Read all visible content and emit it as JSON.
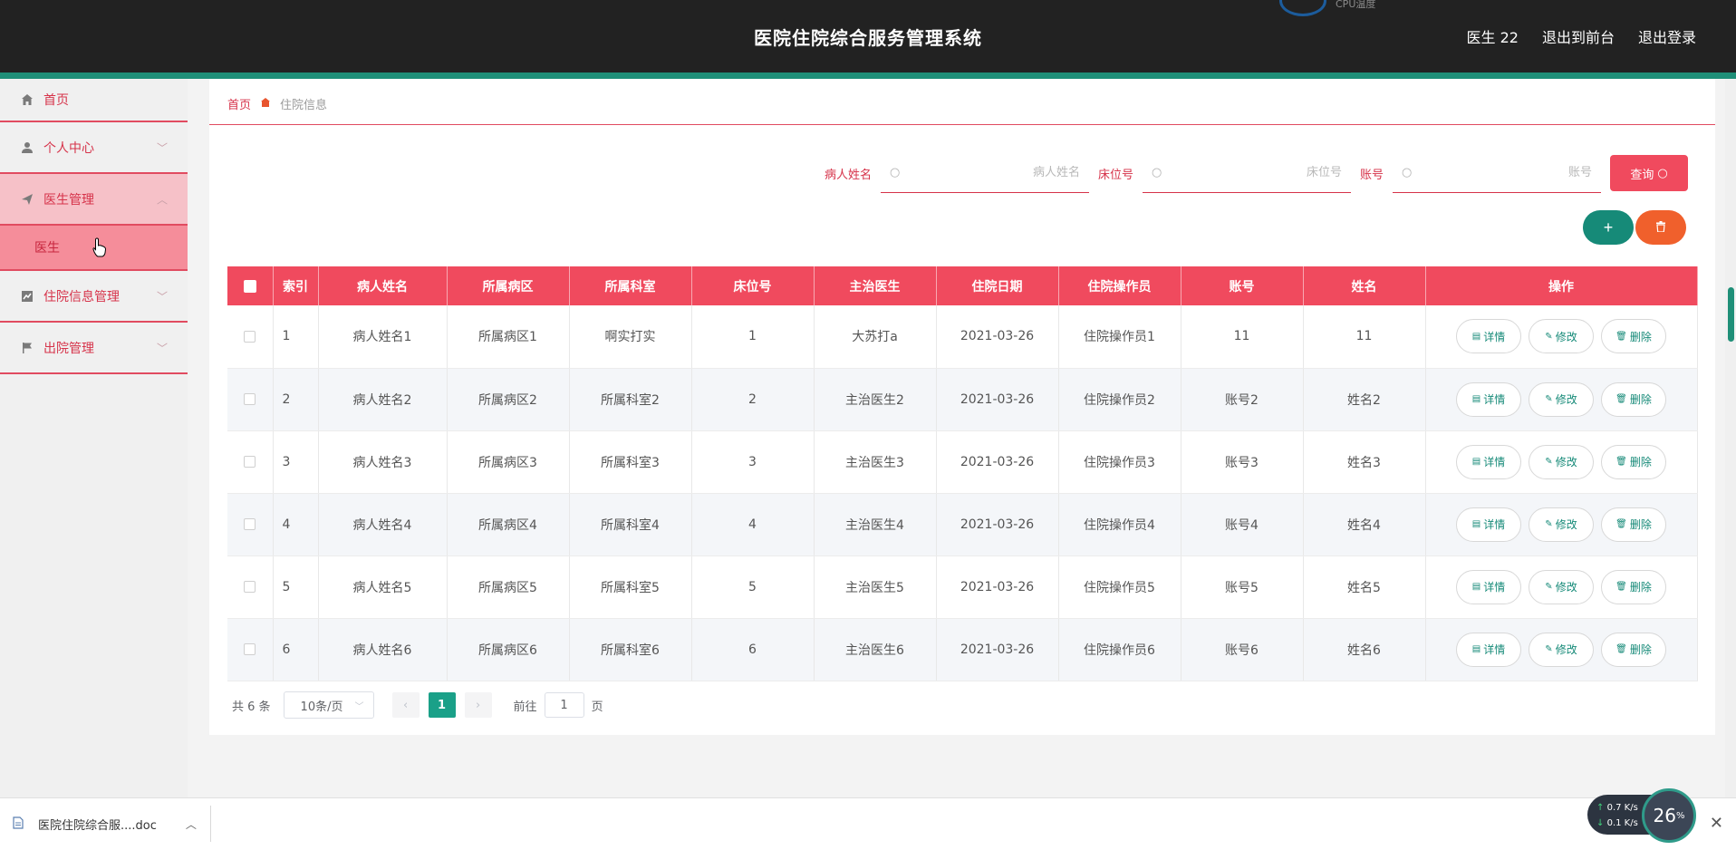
{
  "header": {
    "title": "医院住院综合服务管理系统",
    "user": "医生 22",
    "to_front": "退出到前台",
    "logout": "退出登录",
    "cpu_label": "CPU温度"
  },
  "sidebar": {
    "items": [
      {
        "label": "首页",
        "icon": "home-icon"
      },
      {
        "label": "个人中心",
        "icon": "user-icon"
      },
      {
        "label": "医生管理",
        "icon": "paper-plane-icon"
      },
      {
        "label": "住院信息管理",
        "icon": "chart-icon"
      },
      {
        "label": "出院管理",
        "icon": "flag-icon"
      }
    ],
    "sub_item": "医生"
  },
  "breadcrumb": {
    "home": "首页",
    "current": "住院信息"
  },
  "search": {
    "patient_label": "病人姓名",
    "patient_placeholder": "病人姓名",
    "bed_label": "床位号",
    "bed_placeholder": "床位号",
    "account_label": "账号",
    "account_placeholder": "账号",
    "button": "查询"
  },
  "table": {
    "headers": [
      "索引",
      "病人姓名",
      "所属病区",
      "所属科室",
      "床位号",
      "主治医生",
      "住院日期",
      "住院操作员",
      "账号",
      "姓名",
      "操作"
    ],
    "rows": [
      [
        "1",
        "病人姓名1",
        "所属病区1",
        "啊实打实",
        "1",
        "大苏打a",
        "2021-03-26",
        "住院操作员1",
        "11",
        "11"
      ],
      [
        "2",
        "病人姓名2",
        "所属病区2",
        "所属科室2",
        "2",
        "主治医生2",
        "2021-03-26",
        "住院操作员2",
        "账号2",
        "姓名2"
      ],
      [
        "3",
        "病人姓名3",
        "所属病区3",
        "所属科室3",
        "3",
        "主治医生3",
        "2021-03-26",
        "住院操作员3",
        "账号3",
        "姓名3"
      ],
      [
        "4",
        "病人姓名4",
        "所属病区4",
        "所属科室4",
        "4",
        "主治医生4",
        "2021-03-26",
        "住院操作员4",
        "账号4",
        "姓名4"
      ],
      [
        "5",
        "病人姓名5",
        "所属病区5",
        "所属科室5",
        "5",
        "主治医生5",
        "2021-03-26",
        "住院操作员5",
        "账号5",
        "姓名5"
      ],
      [
        "6",
        "病人姓名6",
        "所属病区6",
        "所属科室6",
        "6",
        "主治医生6",
        "2021-03-26",
        "住院操作员6",
        "账号6",
        "姓名6"
      ]
    ],
    "actions": {
      "detail": "详情",
      "edit": "修改",
      "delete": "删除"
    }
  },
  "pagination": {
    "total": "共 6 条",
    "page_size": "10条/页",
    "current_page": "1",
    "goto_label": "前往",
    "goto_value": "1",
    "page_suffix": "页"
  },
  "downloads": {
    "file": "医院住院综合服....doc"
  },
  "net_widget": {
    "up": "0.7",
    "down": "0.1",
    "unit": "K/s",
    "percent": "26",
    "percent_sign": "%"
  },
  "colors": {
    "header_bg": "#222222",
    "accent_red": "#f04a5e",
    "accent_green": "#168a78",
    "accent_orange": "#f0602c"
  }
}
